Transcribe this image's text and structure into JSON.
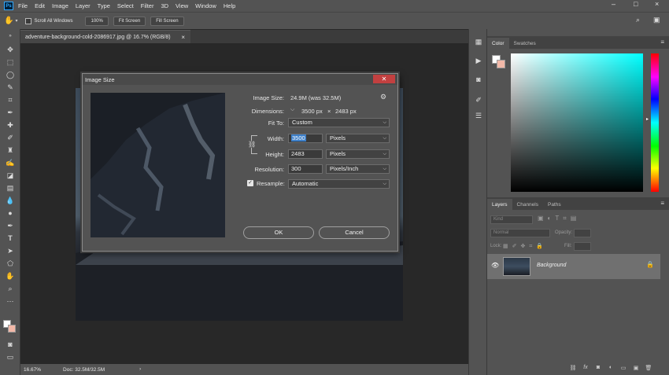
{
  "colors": {
    "accent": "#31a8ff",
    "ui_bg": "#535353",
    "canvas_bg": "#282828",
    "dialog_close": "#c24040"
  },
  "menubar": {
    "logo": "Ps",
    "items": [
      "File",
      "Edit",
      "Image",
      "Layer",
      "Type",
      "Select",
      "Filter",
      "3D",
      "View",
      "Window",
      "Help"
    ],
    "window_controls": [
      "–",
      "□",
      "×"
    ]
  },
  "optionsbar": {
    "scroll_all_windows": "Scroll All Windows",
    "zoom_100": "100%",
    "fit_screen": "Fit Screen",
    "fill_screen": "Fill Screen"
  },
  "document": {
    "tab_title": "adventure-background-cold-2086917.jpg @ 16.7% (RGB/8)",
    "tab_close": "×"
  },
  "status": {
    "zoom": "16.67%",
    "doc": "Doc: 32.5M/32.5M"
  },
  "dialog": {
    "title": "Image Size",
    "image_size_label": "Image Size:",
    "image_size_value": "24.9M (was 32.5M)",
    "dimensions_label": "Dimensions:",
    "dimensions_width": "3500 px",
    "dimensions_sep": "×",
    "dimensions_height": "2483 px",
    "fit_to_label": "Fit To:",
    "fit_to_value": "Custom",
    "width_label": "Width:",
    "width_value": "3500",
    "width_unit": "Pixels",
    "height_label": "Height:",
    "height_value": "2483",
    "height_unit": "Pixels",
    "resolution_label": "Resolution:",
    "resolution_value": "300",
    "resolution_unit": "Pixels/Inch",
    "resample_label": "Resample:",
    "resample_value": "Automatic",
    "resample_checked": true,
    "ok": "OK",
    "cancel": "Cancel"
  },
  "panels": {
    "color_tabs": [
      "Color",
      "Swatches"
    ],
    "layers_tabs": [
      "Layers",
      "Channels",
      "Paths"
    ],
    "kind_placeholder": "Kind",
    "blend_mode": "Normal",
    "opacity_label": "Opacity:",
    "lock_label": "Lock:",
    "fill_label": "Fill:",
    "layer_name": "Background",
    "menu_icon": "≡"
  }
}
